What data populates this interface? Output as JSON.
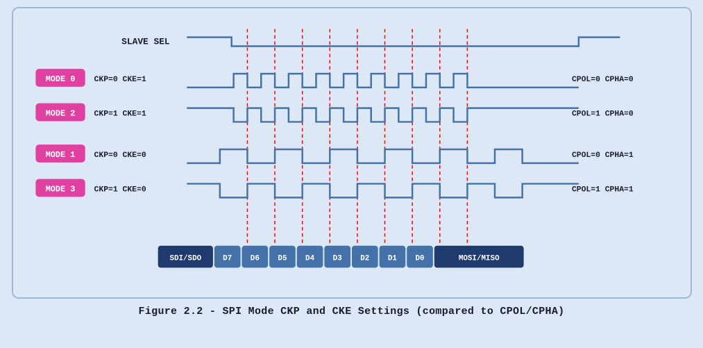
{
  "caption": "Figure 2.2 - SPI Mode CKP and CKE Settings (compared to CPOL/CPHA)",
  "diagram": {
    "slave_sel_label": "SLAVE SEL",
    "modes": [
      {
        "label": "MODE 0",
        "ckp_cke": "CKP=0 CKE=1",
        "cpol_cpha": "CPOL=0 CPHA=0"
      },
      {
        "label": "MODE 2",
        "ckp_cke": "CKP=1 CKE=1",
        "cpol_cpha": "CPOL=1 CPHA=0"
      },
      {
        "label": "MODE 1",
        "ckp_cke": "CKP=0 CKE=0",
        "cpol_cpha": "CPOL=0 CPHA=1"
      },
      {
        "label": "MODE 3",
        "ckp_cke": "CKP=1 CKE=0",
        "cpol_cpha": "CPOL=1 CPHA=1"
      }
    ],
    "data_bits": [
      "SDI/SDO",
      "D7",
      "D6",
      "D5",
      "D4",
      "D3",
      "D2",
      "D1",
      "D0",
      "MOSI/MISO"
    ]
  }
}
